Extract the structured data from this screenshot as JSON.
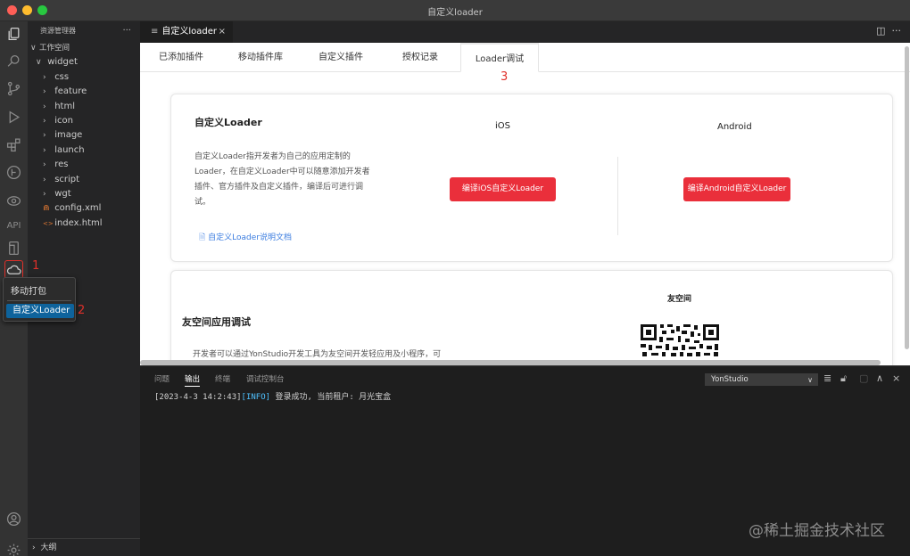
{
  "window": {
    "title": "自定义loader"
  },
  "colors": {
    "accent_red": "#ea2f3b",
    "annotation_red": "#e0302a",
    "selection_blue": "#0e639c",
    "link_blue": "#3d7ee0"
  },
  "activity_bar": {
    "icons": [
      "explorer-icon",
      "search-icon",
      "source-control-icon",
      "run-debug-icon",
      "extensions-icon",
      "deploy-icon",
      "preview-icon",
      "api-icon",
      "device-icon",
      "cloud-package-icon",
      "account-icon",
      "settings-icon"
    ],
    "api_label": "API"
  },
  "explorer": {
    "header": "资源管理器",
    "more": "···",
    "workspace": "工作空间",
    "tree": [
      {
        "label": "widget",
        "level": 1,
        "type": "folder-open"
      },
      {
        "label": "css",
        "level": 2,
        "type": "folder"
      },
      {
        "label": "feature",
        "level": 2,
        "type": "folder"
      },
      {
        "label": "html",
        "level": 2,
        "type": "folder"
      },
      {
        "label": "icon",
        "level": 2,
        "type": "folder"
      },
      {
        "label": "image",
        "level": 2,
        "type": "folder"
      },
      {
        "label": "launch",
        "level": 2,
        "type": "folder"
      },
      {
        "label": "res",
        "level": 2,
        "type": "folder"
      },
      {
        "label": "script",
        "level": 2,
        "type": "folder"
      },
      {
        "label": "wgt",
        "level": 2,
        "type": "folder"
      },
      {
        "label": "config.xml",
        "level": 2,
        "type": "xml"
      },
      {
        "label": "index.html",
        "level": 2,
        "type": "html"
      }
    ],
    "outline": "大纲"
  },
  "popup_menu": {
    "item1": "移动打包",
    "item2": "自定义Loader"
  },
  "annotations": {
    "a1": "1",
    "a2": "2",
    "a3": "3"
  },
  "editor_tab": {
    "label": "自定义loader",
    "close": "×"
  },
  "webview": {
    "tabs": [
      "已添加插件",
      "移动插件库",
      "自定义插件",
      "授权记录",
      "Loader调试"
    ],
    "loader_card": {
      "title": "自定义Loader",
      "description": "自定义Loader指开发者为自己的应用定制的Loader，在自定义Loader中可以随意添加开发者插件、官方插件及自定义插件，编译后可进行调试。",
      "doc_link": "自定义Loader说明文档",
      "ios_label": "iOS",
      "ios_button": "编译iOS自定义Loader",
      "android_label": "Android",
      "android_button": "编译Android自定义Loader"
    },
    "friend_card": {
      "title": "友空间应用调试",
      "platform": "友空间",
      "desc_partial": "开发者可以通过YonStudio开发工具为友空间开发轻应用及小程序，可"
    }
  },
  "panel": {
    "tabs": [
      "问题",
      "输出",
      "终端",
      "调试控制台"
    ],
    "active_tab": "输出",
    "channel": "YonStudio",
    "log": {
      "time": "[2023-4-3 14:2:43]",
      "level": "[INFO]",
      "message": " 登录成功, 当前租户: 月光宝盒"
    }
  },
  "watermark": "@稀土掘金技术社区"
}
